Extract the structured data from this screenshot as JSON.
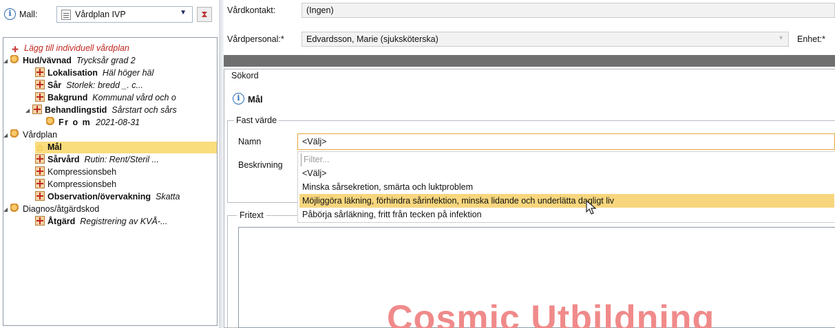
{
  "left": {
    "mall_label": "Mall:",
    "mall_value": "Vårdplan IVP",
    "tree": {
      "add_plan": "Lägg till individuell vårdplan",
      "hud_title": "Hud/vävnad",
      "hud_detail": "Trycksår grad 2",
      "lokalisation": "Lokalisation",
      "lokalisation_detail": "Häl höger häl",
      "sar": "Sår",
      "sar_detail": "Storlek: bredd _. c...",
      "bakgrund": "Bakgrund",
      "bakgrund_detail": "Kommunal vård och o",
      "behandlingstid": "Behandlingstid",
      "behandlingstid_detail": "Sårstart och sårs",
      "from": "Fr o m",
      "from_detail": "2021-08-31",
      "vardplan": "Vårdplan",
      "mal": "Mål",
      "sarvard": "Sårvård",
      "sarvard_detail": "Rutin: Rent/Steril ...",
      "kompression1": "Kompressionsbeh",
      "kompression2": "Kompressionsbeh",
      "observation": "Observation/övervakning",
      "observation_detail": "Skatta",
      "diagnos": "Diagnos/åtgärdskod",
      "atgard": "Åtgärd",
      "atgard_detail": "Registrering av KVÅ-..."
    }
  },
  "right": {
    "vardkontakt_label": "Vårdkontakt:",
    "vardkontakt_value": "(Ingen)",
    "vardpersonal_label": "Vårdpersonal:*",
    "vardpersonal_value": "Edvardsson, Marie (sjuksköterska)",
    "enhet_label": "Enhet:*",
    "sokord_label": "Sökord",
    "mal_heading": "Mål",
    "fast_label": "Fast värde",
    "namn_label": "Namn",
    "namn_value": "<Välj>",
    "beskrivning_label": "Beskrivning",
    "dropdown": {
      "filter_placeholder": "Filter...",
      "items": [
        "<Välj>",
        "Minska sårsekretion, smärta och  luktproblem",
        "Möjliggöra läkning, förhindra sårinfektion, minska lidande och underlätta dagligt liv",
        "Påbörja sårläkning, fritt från tecken på infektion"
      ]
    },
    "fritext_label": "Fritext",
    "watermark": "Cosmic Utbildning"
  }
}
